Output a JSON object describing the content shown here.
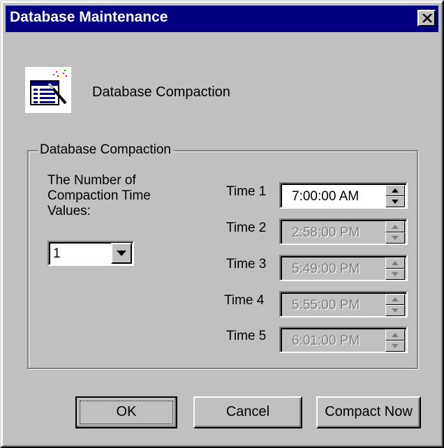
{
  "window": {
    "title": "Database Maintenance"
  },
  "header": {
    "label": "Database Compaction"
  },
  "group": {
    "legend": "Database Compaction",
    "count_label": "The Number of Compaction Time Values:",
    "count_value": "1"
  },
  "times": [
    {
      "label": "Time 1",
      "value": "7:00:00 AM",
      "enabled": true
    },
    {
      "label": "Time 2",
      "value": "2:58:00 PM",
      "enabled": false
    },
    {
      "label": "Time 3",
      "value": "5:49:00 PM",
      "enabled": false
    },
    {
      "label": "Time 4",
      "value": "5:55:00 PM",
      "enabled": false
    },
    {
      "label": "Time 5",
      "value": "6:01:00 PM",
      "enabled": false
    }
  ],
  "buttons": {
    "ok": "OK",
    "cancel": "Cancel",
    "compact_now": "Compact Now"
  },
  "colors": {
    "titlebar": "#000080",
    "face": "#c0c0c0",
    "disabled_text": "#808080"
  }
}
